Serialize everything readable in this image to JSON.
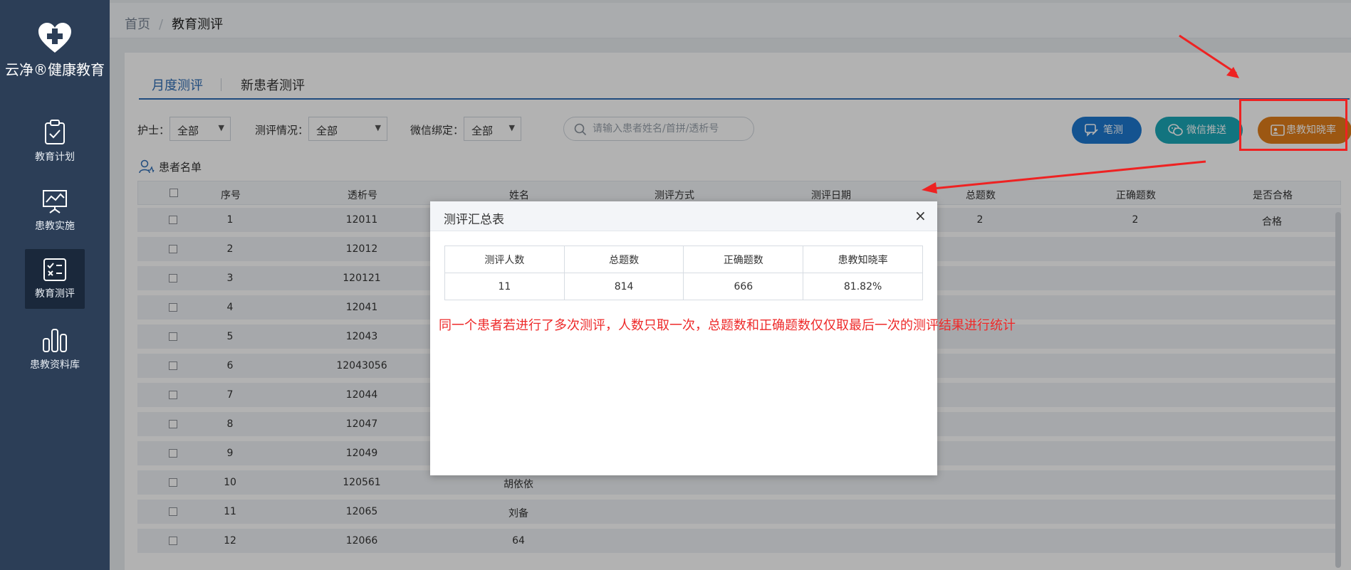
{
  "app": {
    "logo_text": "云净®健康教育"
  },
  "sidebar": {
    "items": [
      {
        "label": "教育计划",
        "icon": "clipboard-check-icon"
      },
      {
        "label": "患教实施",
        "icon": "presentation-board-icon"
      },
      {
        "label": "教育测评",
        "icon": "checklist-icon",
        "active": true
      },
      {
        "label": "患教资料库",
        "icon": "bar-chart-icon"
      }
    ]
  },
  "breadcrumb": {
    "home": "首页",
    "sep": "/",
    "current": "教育测评"
  },
  "tabs": [
    {
      "label": "月度测评",
      "active": true
    },
    {
      "label": "新患者测评"
    }
  ],
  "filters": {
    "nurse_label": "护士：",
    "nurse_value": "全部",
    "eval_label": "测评情况：",
    "eval_value": "全部",
    "wechat_label": "微信绑定：",
    "wechat_value": "全部",
    "search_placeholder": "请输入患者姓名/首拼/透析号"
  },
  "buttons": {
    "written": "笔测",
    "wechat_push": "微信推送",
    "awareness": "患教知晓率"
  },
  "list_label": "患者名单",
  "table": {
    "headers": [
      "序号",
      "透析号",
      "姓名",
      "测评方式",
      "测评日期",
      "总题数",
      "正确题数",
      "是否合格"
    ],
    "rows": [
      {
        "no": "1",
        "dialysis": "12011",
        "name": "",
        "total": "2",
        "correct": "2",
        "pass": "合格"
      },
      {
        "no": "2",
        "dialysis": "12012",
        "name": ""
      },
      {
        "no": "3",
        "dialysis": "120121",
        "name": ""
      },
      {
        "no": "4",
        "dialysis": "12041",
        "name": ""
      },
      {
        "no": "5",
        "dialysis": "12043",
        "name": ""
      },
      {
        "no": "6",
        "dialysis": "12043056",
        "name": ""
      },
      {
        "no": "7",
        "dialysis": "12044",
        "name": ""
      },
      {
        "no": "8",
        "dialysis": "12047",
        "name": ""
      },
      {
        "no": "9",
        "dialysis": "12049",
        "name": ""
      },
      {
        "no": "10",
        "dialysis": "120561",
        "name": "胡依依"
      },
      {
        "no": "11",
        "dialysis": "12065",
        "name": "刘备"
      },
      {
        "no": "12",
        "dialysis": "12066",
        "name": "64"
      }
    ]
  },
  "modal": {
    "title": "测评汇总表",
    "close": "×",
    "headers": [
      "测评人数",
      "总题数",
      "正确题数",
      "患教知晓率"
    ],
    "values": [
      "11",
      "814",
      "666",
      "81.82%"
    ]
  },
  "annotation": "同一个患者若进行了多次测评，人数只取一次，总题数和正确题数仅仅取最后一次的测评结果进行统计",
  "colors": {
    "sidebar": "#2c3e57",
    "accent": "#2f6db5",
    "btn_blue": "#1d78cf",
    "btn_teal": "#1aa6b7",
    "btn_orange": "#e07d1a",
    "annotation_red": "#ee2a2a"
  }
}
